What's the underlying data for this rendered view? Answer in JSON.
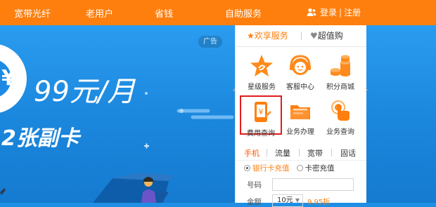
{
  "nav": {
    "items": [
      "宽带光纤",
      "老用户",
      "省钱",
      "自助服务"
    ],
    "login": "登录",
    "separator": "|",
    "register": "注册"
  },
  "banner": {
    "ad_tag": "广告",
    "price": "99元/月",
    "cards": "2张副卡"
  },
  "panel": {
    "tabs": [
      {
        "label": "欢享服务",
        "icon": "star-icon",
        "active": true
      },
      {
        "label": "超值购",
        "icon": "heart-icon",
        "active": false
      }
    ],
    "services": [
      {
        "label": "星级服务",
        "icon": "star-service-icon"
      },
      {
        "label": "客服中心",
        "icon": "headset-icon"
      },
      {
        "label": "积分商城",
        "icon": "coins-icon"
      },
      {
        "label": "费用查询",
        "icon": "bill-phone-icon"
      },
      {
        "label": "业务办理",
        "icon": "folder-icon"
      },
      {
        "label": "业务查询",
        "icon": "touch-icon"
      }
    ],
    "subtabs": [
      "手机",
      "流量",
      "宽带",
      "固话"
    ],
    "radio": {
      "option1": "银行卡充值",
      "option2": "卡密充值"
    },
    "form": {
      "number_label": "号码",
      "amount_label": "金额",
      "amount_value": "10元",
      "discount": "9.95折"
    }
  },
  "colors": {
    "nav_bg": "#ff7f0e",
    "accent": "#ff7f0e",
    "banner_bg": "#1e8fe4",
    "highlight": "#e21c1c"
  }
}
